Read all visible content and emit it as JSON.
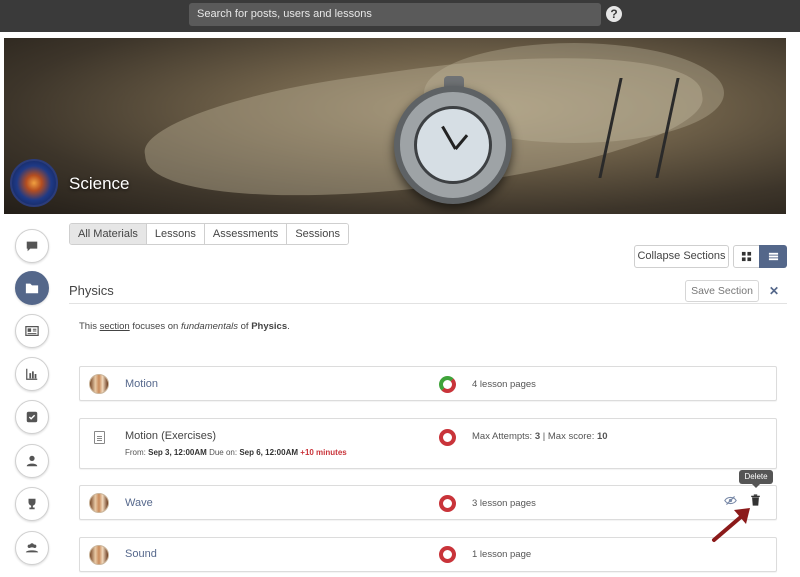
{
  "topbar": {
    "search_placeholder": "Search for posts, users and lessons",
    "help_label": "?"
  },
  "banner": {
    "title": "Science"
  },
  "sidebar": {
    "items": [
      {
        "icon": "chat-icon"
      },
      {
        "icon": "folder-icon",
        "active": true
      },
      {
        "icon": "newspaper-icon"
      },
      {
        "icon": "bar-chart-icon"
      },
      {
        "icon": "checkbox-icon"
      },
      {
        "icon": "user-icon"
      },
      {
        "icon": "trophy-icon"
      },
      {
        "icon": "group-icon"
      }
    ]
  },
  "tabs": [
    {
      "label": "All Materials",
      "active": true
    },
    {
      "label": "Lessons"
    },
    {
      "label": "Assessments"
    },
    {
      "label": "Sessions"
    }
  ],
  "toolbar": {
    "collapse_label": "Collapse Sections"
  },
  "section": {
    "title": "Physics",
    "save_label": "Save Section",
    "close_label": "✕",
    "desc": {
      "prefix": "This",
      "link": "section",
      "mid1": "focuses on",
      "em": "fundamentals",
      "mid2": "of",
      "strong": "Physics",
      "suffix": "."
    }
  },
  "rows": [
    {
      "title": "Motion",
      "meta": "4 lesson pages",
      "status": "partial"
    },
    {
      "title": "Motion (Exercises)",
      "meta_prefix": "Max Attempts:",
      "meta_attempts": "3",
      "meta_sep": "| Max score:",
      "meta_score": "10",
      "sub_from": "From:",
      "sub_from_val": "Sep 3, 12:00AM",
      "sub_due": "Due on:",
      "sub_due_val": "Sep 6, 12:00AM",
      "sub_extra": "+10 minutes",
      "status": "incomplete"
    },
    {
      "title": "Wave",
      "meta": "3 lesson pages",
      "status": "incomplete"
    },
    {
      "title": "Sound",
      "meta": "1 lesson page",
      "status": "incomplete"
    }
  ],
  "tooltip": {
    "label": "Delete"
  },
  "colors": {
    "accent": "#54678a",
    "status_red": "#c9343a",
    "status_green": "#3fa33a",
    "annotation_arrow": "#8b1a1a"
  }
}
